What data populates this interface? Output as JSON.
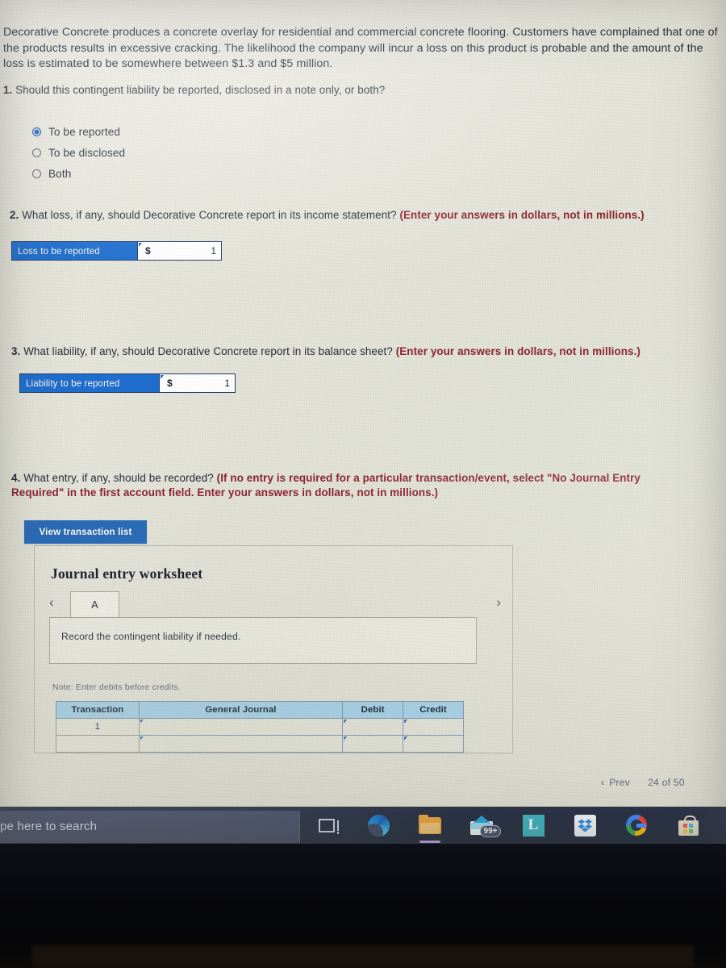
{
  "intro": {
    "paragraph": "Decorative Concrete produces a concrete overlay for residential and commercial concrete flooring. Customers have complained that one of the products results in excessive cracking. The likelihood the company will incur a loss on this product is probable and the amount of the loss is estimated to be somewhere between $1.3 and $5 million."
  },
  "q1": {
    "number": "1.",
    "text": " Should this contingent liability be reported, disclosed in a note only, or both?",
    "options": [
      {
        "label": "To be reported",
        "selected": true
      },
      {
        "label": "To be disclosed",
        "selected": false
      },
      {
        "label": "Both",
        "selected": false
      }
    ]
  },
  "q2": {
    "number": "2.",
    "text": " What loss, if any, should Decorative Concrete report in its income statement? ",
    "hint": "(Enter your answers in dollars, not in millions.)",
    "answer_row": {
      "label": "Loss to be reported",
      "currency": "$",
      "value": "1"
    }
  },
  "q3": {
    "number": "3.",
    "text": " What liability, if any, should Decorative Concrete report in its balance sheet? ",
    "hint": "(Enter your answers in dollars, not in millions.)",
    "answer_row": {
      "label": "Liability to be reported",
      "currency": "$",
      "value": "1"
    }
  },
  "q4": {
    "number": "4.",
    "text": " What entry, if any, should be recorded? ",
    "hint": "(If no entry is required for a particular transaction/event, select \"No Journal Entry Required\" in the first account field. Enter your answers in dollars, not in millions.)",
    "view_button": "View transaction list"
  },
  "worksheet": {
    "title": "Journal entry worksheet",
    "prev_icon": "chevron-left-icon",
    "next_icon": "chevron-right-icon",
    "tabs": [
      {
        "label": "A",
        "active": true
      }
    ],
    "instruction": "Record the contingent liability if needed.",
    "note": "Note: Enter debits before credits.",
    "table": {
      "headers": [
        "Transaction",
        "General Journal",
        "Debit",
        "Credit"
      ],
      "rows": [
        {
          "transaction": "1",
          "general_journal": "",
          "debit": "",
          "credit": ""
        },
        {
          "transaction": "",
          "general_journal": "",
          "debit": "",
          "credit": ""
        }
      ]
    }
  },
  "pager": {
    "prev_icon": "chevron-left-icon",
    "prev_label": "Prev",
    "page_count": "24 of 50"
  },
  "taskbar": {
    "search_placeholder": "pe here to search",
    "icons": [
      {
        "name": "task-view-icon",
        "label": "Task View"
      },
      {
        "name": "edge-icon",
        "label": "Microsoft Edge"
      },
      {
        "name": "file-explorer-icon",
        "label": "File Explorer"
      },
      {
        "name": "mail-icon",
        "label": "Mail",
        "badge": "99+"
      },
      {
        "name": "lockdown-browser-icon",
        "label": "L"
      },
      {
        "name": "dropbox-icon",
        "label": "Dropbox"
      },
      {
        "name": "chrome-icon",
        "label": "Google Chrome"
      },
      {
        "name": "microsoft-store-icon",
        "label": "Microsoft Store"
      }
    ]
  },
  "colors": {
    "accent_blue": "#2b6cb8",
    "label_blue": "#1f6fd0",
    "hint_red": "#8d2230",
    "table_header_blue": "#a5cde3",
    "page_background": "#e5e4d9"
  }
}
